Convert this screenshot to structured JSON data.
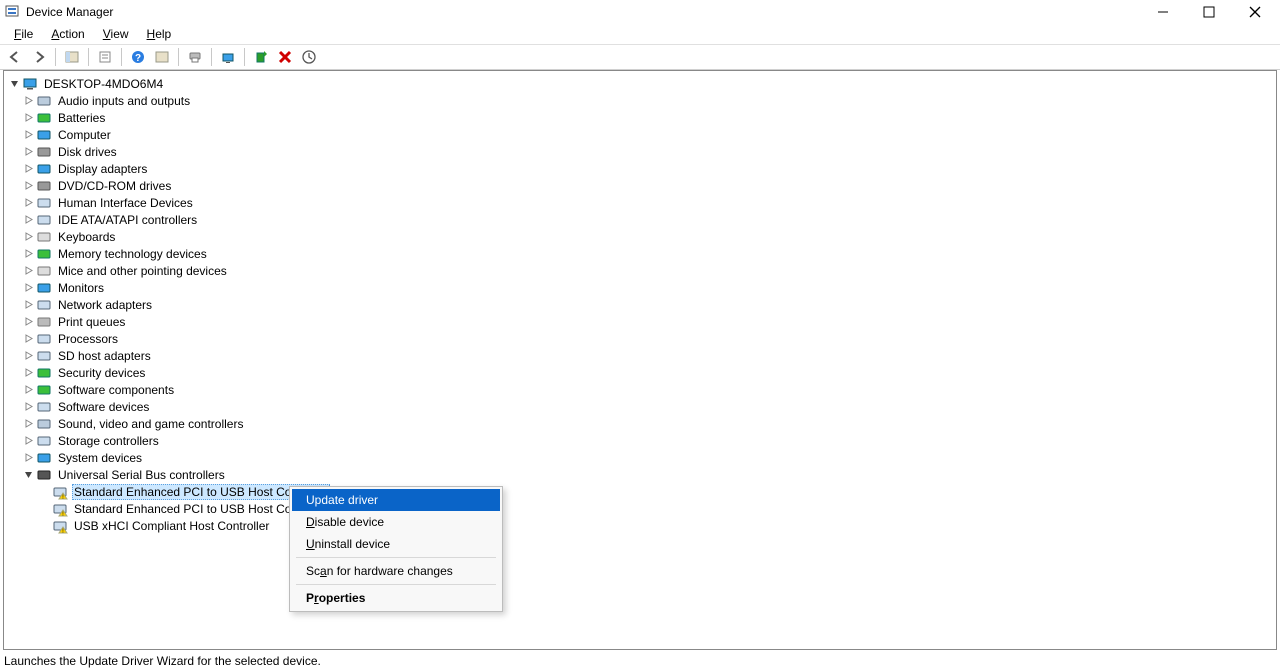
{
  "window": {
    "title": "Device Manager"
  },
  "menu": {
    "file": "File",
    "action": "Action",
    "view": "View",
    "help": "Help"
  },
  "root_name": "DESKTOP-4MDO6M4",
  "categories": [
    "Audio inputs and outputs",
    "Batteries",
    "Computer",
    "Disk drives",
    "Display adapters",
    "DVD/CD-ROM drives",
    "Human Interface Devices",
    "IDE ATA/ATAPI controllers",
    "Keyboards",
    "Memory technology devices",
    "Mice and other pointing devices",
    "Monitors",
    "Network adapters",
    "Print queues",
    "Processors",
    "SD host adapters",
    "Security devices",
    "Software components",
    "Software devices",
    "Sound, video and game controllers",
    "Storage controllers",
    "System devices",
    "Universal Serial Bus controllers"
  ],
  "usb_children": [
    "Standard Enhanced PCI to USB Host Controller",
    "Standard Enhanced PCI to USB Host Controller",
    "USB xHCI Compliant Host Controller"
  ],
  "context_menu": {
    "update": "Update driver",
    "disable": "Disable device",
    "uninstall": "Uninstall device",
    "scan": "Scan for hardware changes",
    "properties": "Properties"
  },
  "status_text": "Launches the Update Driver Wizard for the selected device."
}
